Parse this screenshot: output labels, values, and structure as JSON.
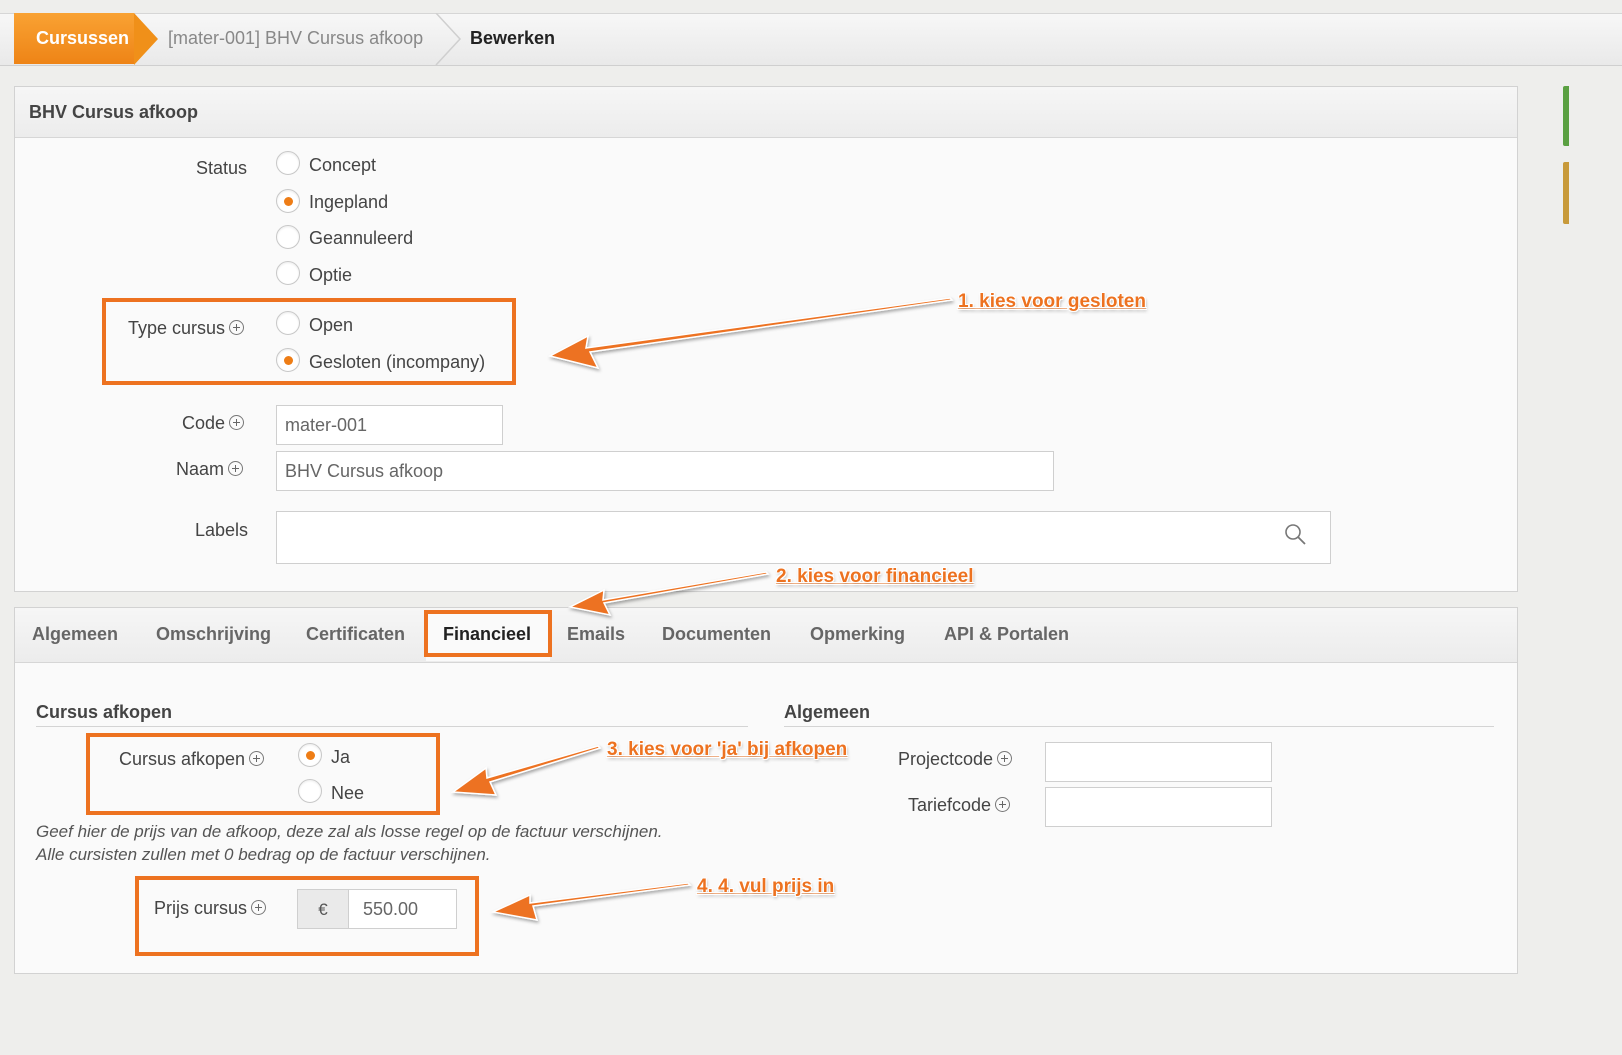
{
  "breadcrumb": {
    "root": "Cursussen",
    "course": "[mater-001] BHV Cursus afkoop",
    "current": "Bewerken"
  },
  "panel": {
    "title": "BHV Cursus afkoop"
  },
  "status": {
    "label": "Status",
    "options": [
      "Concept",
      "Ingepland",
      "Geannuleerd",
      "Optie"
    ],
    "selected": "Ingepland"
  },
  "type_cursus": {
    "label": "Type cursus",
    "options": [
      "Open",
      "Gesloten (incompany)"
    ],
    "selected": "Gesloten (incompany)"
  },
  "code": {
    "label": "Code",
    "value": "mater-001"
  },
  "naam": {
    "label": "Naam",
    "value": "BHV Cursus afkoop"
  },
  "labels": {
    "label": "Labels",
    "value": ""
  },
  "tabs": [
    "Algemeen",
    "Omschrijving",
    "Certificaten",
    "Financieel",
    "Emails",
    "Documenten",
    "Opmerking",
    "API & Portalen"
  ],
  "active_tab": "Financieel",
  "afkopen": {
    "section_title": "Cursus afkopen",
    "label": "Cursus afkopen",
    "options": [
      "Ja",
      "Nee"
    ],
    "selected": "Ja",
    "help_line1": "Geef hier de prijs van de afkoop, deze zal als losse regel op de factuur verschijnen.",
    "help_line2": "Alle cursisten zullen met 0 bedrag op de factuur verschijnen.",
    "price_label": "Prijs cursus",
    "currency": "€",
    "price_value": "550.00"
  },
  "algemeen": {
    "section_title": "Algemeen",
    "projectcode_label": "Projectcode",
    "projectcode_value": "",
    "tariefcode_label": "Tariefcode",
    "tariefcode_value": ""
  },
  "annotations": {
    "step1": "1. kies voor gesloten",
    "step2": "2. kies voor financieel",
    "step3": "3. kies voor 'ja' bij afkopen",
    "step4": "4. 4. vul prijs in"
  },
  "colors": {
    "accent": "#ed7220",
    "breadcrumb_active": "#f09019",
    "side_marker_green": "#5aa042",
    "side_marker_gold": "#c89a3a"
  }
}
